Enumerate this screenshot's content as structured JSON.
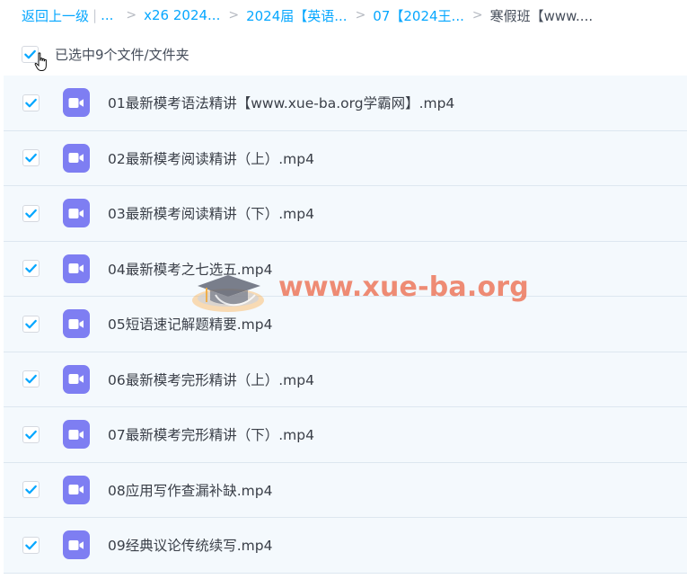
{
  "breadcrumb": {
    "back": "返回上一级",
    "ellipsis": "...",
    "items": [
      "x26 2024...",
      "2024届【英语...",
      "07【2024王..."
    ],
    "current": "寒假班【www...."
  },
  "selection": {
    "label": "已选中9个文件/文件夹",
    "checked": true
  },
  "files": [
    {
      "name": "01最新模考语法精讲【www.xue-ba.org学霸网】.mp4",
      "checked": true,
      "type": "video-icon"
    },
    {
      "name": "02最新模考阅读精讲（上）.mp4",
      "checked": true,
      "type": "video-icon"
    },
    {
      "name": "03最新模考阅读精讲（下）.mp4",
      "checked": true,
      "type": "video-icon"
    },
    {
      "name": "04最新模考之七选五.mp4",
      "checked": true,
      "type": "video-icon"
    },
    {
      "name": "05短语速记解题精要.mp4",
      "checked": true,
      "type": "video-icon"
    },
    {
      "name": "06最新模考完形精讲（上）.mp4",
      "checked": true,
      "type": "video-icon"
    },
    {
      "name": "07最新模考完形精讲（下）.mp4",
      "checked": true,
      "type": "video-icon"
    },
    {
      "name": "08应用写作查漏补缺.mp4",
      "checked": true,
      "type": "video-icon"
    },
    {
      "name": "09经典议论传统续写.mp4",
      "checked": true,
      "type": "video-icon"
    }
  ],
  "watermark": {
    "text": "www.xue-ba.org"
  },
  "colors": {
    "link": "#06a7ff",
    "check": "#06a7ff",
    "video_icon_bg": "#7e7ef2",
    "row_bg": "#f4f9fd",
    "watermark": "#eb603e"
  }
}
